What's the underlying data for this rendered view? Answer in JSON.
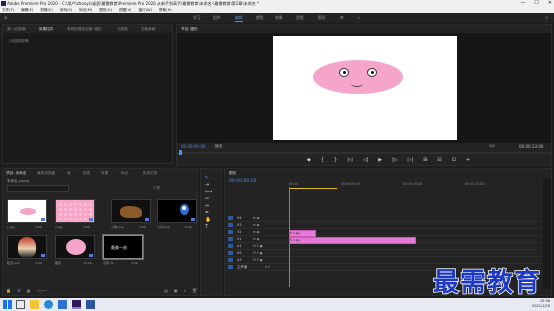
{
  "window": {
    "title": "Adobe Premiere Pro 2020 - C:\\用户\\zhouyz\\桌面\\最需教育\\Premiere Pro 2020 从新手到高手\\最需教育\\未命名-\\最需教育\\第2章\\未命名 *",
    "minimize": "—",
    "maximize": "☐",
    "close": "✕"
  },
  "menu": [
    "文件(F)",
    "编辑(E)",
    "剪辑(C)",
    "序列(S)",
    "标记(M)",
    "图形(G)",
    "视图(V)",
    "窗口(W)",
    "帮助(H)"
  ],
  "workspace": {
    "items": [
      "学习",
      "组件",
      "编辑",
      "颜色",
      "效果",
      "音频",
      "图形",
      "库"
    ],
    "active_index": 2,
    "more": "»"
  },
  "source_panel": {
    "tabs": [
      "源: (无剪辑)",
      "效果控件",
      "音频剪辑混合器: 图形",
      "元数据",
      "旧版音频"
    ],
    "active_tab": 1,
    "empty_text": "(未选择剪辑)"
  },
  "program_monitor": {
    "tab": "节目: 图形",
    "timecode": "00:00:00:00",
    "fit": "适合",
    "resolution": "1/2",
    "duration": "00:00:13:00",
    "controls": [
      "◆",
      "{",
      "}",
      "|◁",
      "◁|",
      "▶",
      "|▷",
      "▷|",
      "⊞",
      "⊟",
      "⊡",
      "+"
    ]
  },
  "project_panel": {
    "tabs": [
      "项目: 未命名",
      "媒体浏览器",
      "库",
      "信息",
      "效果",
      "标记",
      "历史记录"
    ],
    "active_tab": 0,
    "path": "未命名.prproj",
    "item_count": "7 项",
    "items": [
      {
        "label": "1.jpg",
        "duration": "5:00",
        "kind": "pig"
      },
      {
        "label": "2.jpg",
        "duration": "5:00",
        "kind": "pink-pattern"
      },
      {
        "label": "小猪.png",
        "duration": "5:00",
        "kind": "dog"
      },
      {
        "label": "小鸟.png",
        "duration": "5:00",
        "kind": "bird"
      },
      {
        "label": "脸谱.png",
        "duration": "5:00",
        "kind": "mask"
      },
      {
        "label": "图形",
        "duration": "13:00",
        "kind": "pig-pink"
      },
      {
        "label": "字幕 01",
        "duration": "5:00",
        "kind": "title"
      }
    ],
    "title_thumb_text": "最美一刻"
  },
  "timeline": {
    "tab": "图形",
    "timecode": "00:00:00:00",
    "ruler": [
      "00:00",
      "00:00:05:00",
      "00:00:10:00",
      "00:00:15:00"
    ],
    "tracks": [
      {
        "name": "V4",
        "kind": "video"
      },
      {
        "name": "V3",
        "kind": "video"
      },
      {
        "name": "V2",
        "kind": "video"
      },
      {
        "name": "V1",
        "kind": "video"
      },
      {
        "name": "A1",
        "kind": "audio"
      },
      {
        "name": "A2",
        "kind": "audio"
      },
      {
        "name": "A3",
        "kind": "audio"
      },
      {
        "name": "主声道",
        "kind": "master",
        "value": "0.0"
      }
    ],
    "clips": [
      {
        "track": "V2",
        "label": "fx 2.jpg",
        "start": 0,
        "end": 2
      },
      {
        "track": "V1",
        "label": "fx 1.jpg",
        "start": 0,
        "end": 10
      }
    ],
    "ruler_max_seconds": 20
  },
  "taskbar": {
    "time": "15:56",
    "date": "2021/1/20"
  },
  "watermark": "最需教育"
}
